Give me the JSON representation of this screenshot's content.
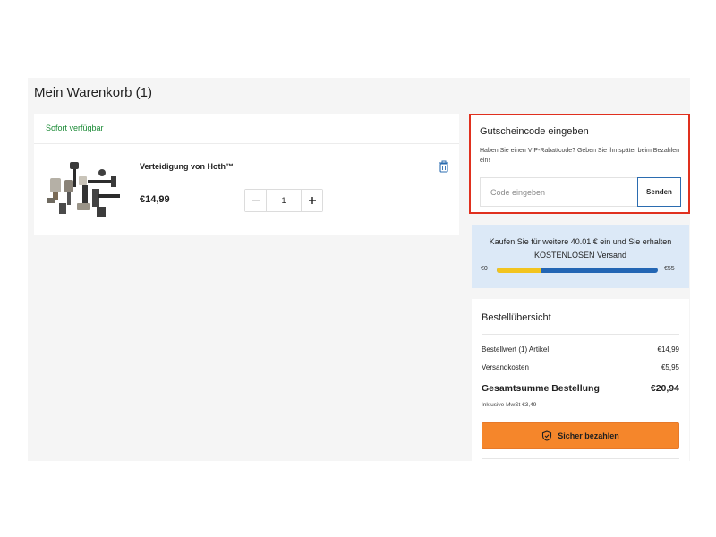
{
  "cart": {
    "title": "Mein Warenkorb (1)",
    "availability": "Sofort verfügbar",
    "item": {
      "name": "Verteidigung von Hoth™",
      "price": "€14,99",
      "quantity": "1",
      "minus_icon": "minus-icon",
      "plus_icon": "plus-icon",
      "delete_icon": "trash-icon"
    }
  },
  "voucher": {
    "title": "Gutscheincode eingeben",
    "description": "Haben Sie einen VIP-Rabattcode? Geben Sie ihn später beim Bezahlen ein!",
    "input_placeholder": "Code eingeben",
    "submit_label": "Senden",
    "highlight_color": "#e0301e"
  },
  "shipping": {
    "message": "Kaufen Sie für weitere 40.01 € ein und Sie erhalten KOSTENLOSEN Versand",
    "min_label": "€0",
    "max_label": "€55",
    "progress_fraction": 0.27,
    "fill_color": "#f2c41f",
    "track_color": "#2366b4"
  },
  "summary": {
    "title": "Bestellübersicht",
    "rows": [
      {
        "label": "Bestellwert (1) Artikel",
        "value": "€14,99"
      },
      {
        "label": "Versandkosten",
        "value": "€5,95"
      }
    ],
    "total_label": "Gesamtsumme Bestellung",
    "total_value": "€20,94",
    "vat_note": "Inklusive MwSt €3,49",
    "pay_label": "Sicher bezahlen",
    "pay_icon": "shield-check-icon",
    "pay_color": "#f5862b"
  }
}
